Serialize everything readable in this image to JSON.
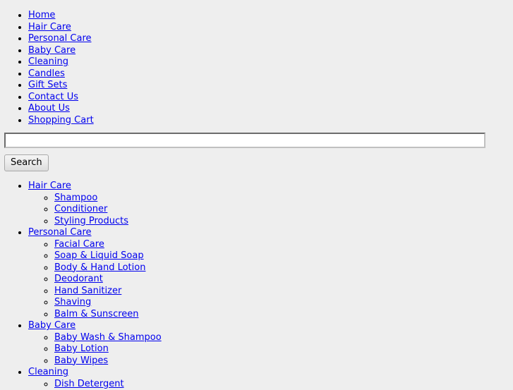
{
  "page": {
    "background_color": "#eeeeee",
    "link_color": "#0000ee"
  },
  "main_nav": {
    "items": [
      {
        "label": "Home"
      },
      {
        "label": "Hair Care"
      },
      {
        "label": "Personal Care"
      },
      {
        "label": "Baby Care"
      },
      {
        "label": "Cleaning"
      },
      {
        "label": "Candles"
      },
      {
        "label": "Gift Sets"
      },
      {
        "label": "Contact Us"
      },
      {
        "label": "About Us"
      },
      {
        "label": "Shopping Cart"
      }
    ]
  },
  "search": {
    "value": "",
    "placeholder": "",
    "button_label": "Search"
  },
  "categories": [
    {
      "label": "Hair Care",
      "children": [
        {
          "label": "Shampoo"
        },
        {
          "label": "Conditioner"
        },
        {
          "label": "Styling Products"
        }
      ]
    },
    {
      "label": "Personal Care",
      "children": [
        {
          "label": "Facial Care"
        },
        {
          "label": "Soap & Liquid Soap"
        },
        {
          "label": "Body & Hand Lotion"
        },
        {
          "label": "Deodorant"
        },
        {
          "label": "Hand Sanitizer"
        },
        {
          "label": "Shaving"
        },
        {
          "label": "Balm & Sunscreen"
        }
      ]
    },
    {
      "label": "Baby Care",
      "children": [
        {
          "label": "Baby Wash & Shampoo"
        },
        {
          "label": "Baby Lotion"
        },
        {
          "label": "Baby Wipes"
        }
      ]
    },
    {
      "label": "Cleaning",
      "children": [
        {
          "label": "Dish Detergent"
        }
      ]
    }
  ]
}
